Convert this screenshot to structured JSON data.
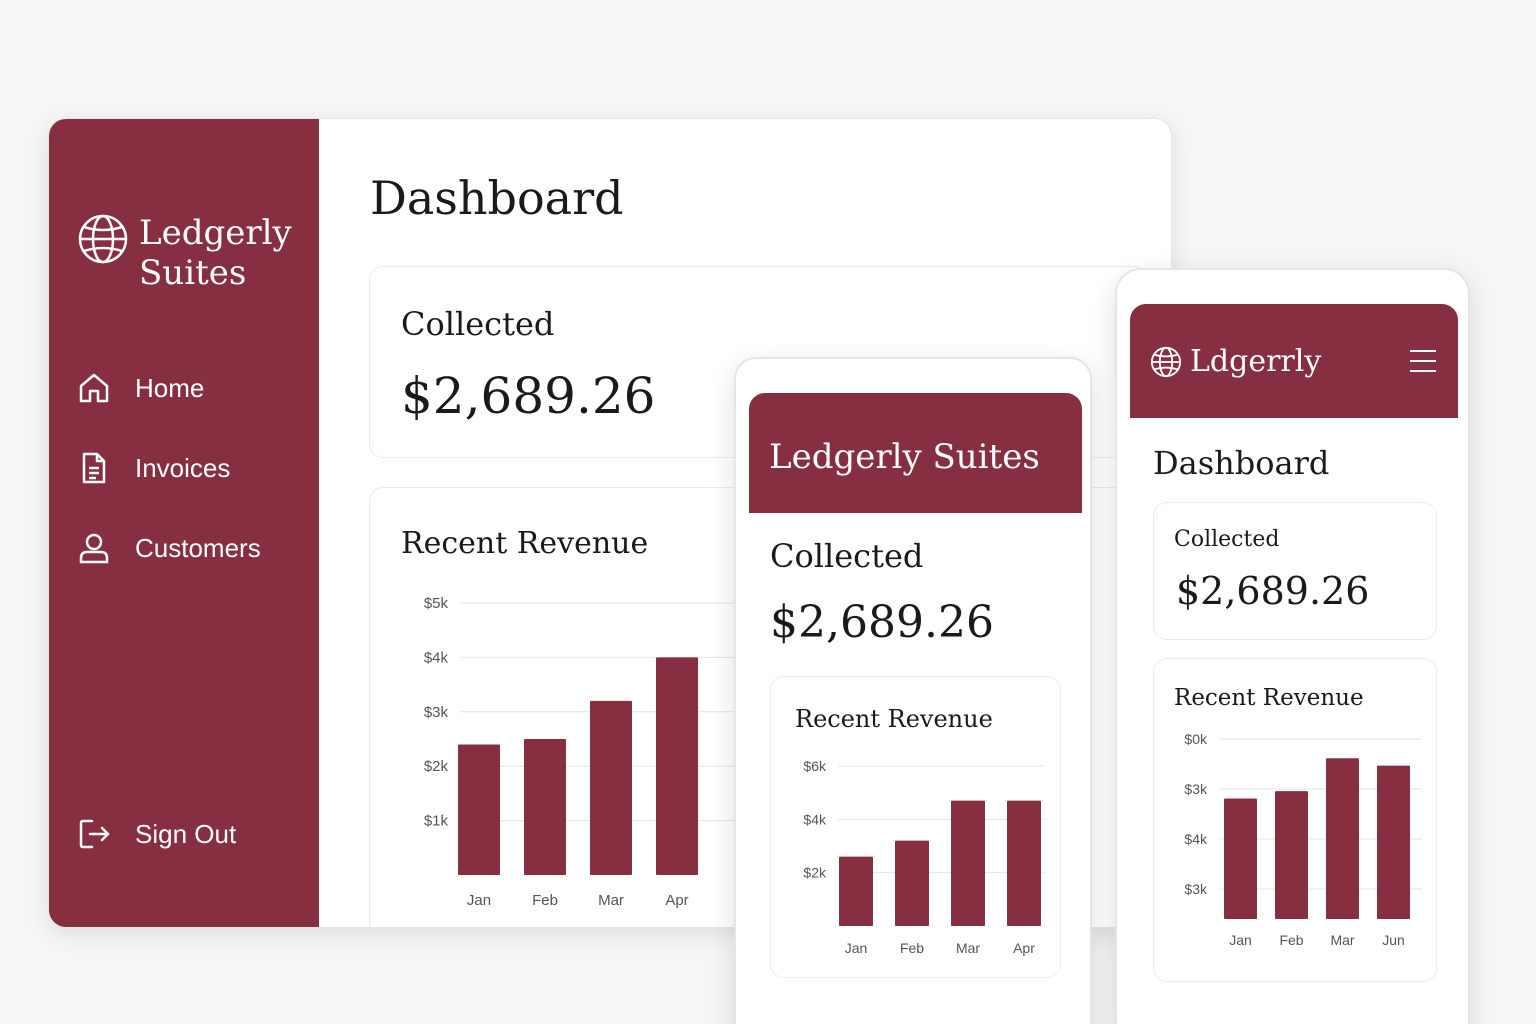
{
  "desktop": {
    "brand": "Ledgerly Suites",
    "nav": [
      {
        "label": "Home",
        "icon": "home-icon"
      },
      {
        "label": "Invoices",
        "icon": "document-icon"
      },
      {
        "label": "Customers",
        "icon": "user-icon"
      }
    ],
    "sign_out": {
      "label": "Sign Out",
      "icon": "sign-out-icon"
    },
    "page_title": "Dashboard",
    "collected": {
      "label": "Collected",
      "amount": "$2,689.26"
    },
    "revenue": {
      "title": "Recent Revenue"
    }
  },
  "tablet": {
    "brand": "Ledgerly Suites",
    "collected": {
      "label": "Collected",
      "amount": "$2,689.26"
    },
    "revenue": {
      "title": "Recent Revenue"
    }
  },
  "phone": {
    "brand": "Ldgerrly",
    "menu_icon": "hamburger-menu-icon",
    "page_title": "Dashboard",
    "collected": {
      "label": "Collected",
      "amount": "$2,689.26"
    },
    "revenue": {
      "title": "Recent Revenue"
    }
  },
  "colors": {
    "brand": "#862f40",
    "background": "#f6f6f6",
    "card": "#ffffff"
  },
  "chart_data": [
    {
      "type": "bar",
      "id": "desktop",
      "categories": [
        "Jan",
        "Feb",
        "Mar",
        "Apr"
      ],
      "values": [
        2400,
        2500,
        3200,
        4000
      ],
      "yticks": [
        "$1k",
        "$2k",
        "$3k",
        "$4k",
        "$5k"
      ],
      "ylim": [
        0,
        5000
      ],
      "grid": true
    },
    {
      "type": "bar",
      "id": "tablet",
      "categories": [
        "Jan",
        "Feb",
        "Mar",
        "Apr"
      ],
      "values": [
        2600,
        3200,
        4700,
        4700
      ],
      "yticks": [
        "$2k",
        "$4k",
        "$6k"
      ],
      "ylim": [
        0,
        6000
      ],
      "grid": true
    },
    {
      "type": "bar",
      "id": "phone",
      "categories": [
        "Jan",
        "Feb",
        "Mar",
        "Jun"
      ],
      "values": [
        3.3,
        3.5,
        4.4,
        4.2
      ],
      "yticks": [
        "$0k",
        "$3k",
        "$4k",
        "$3k"
      ],
      "grid": true
    }
  ]
}
